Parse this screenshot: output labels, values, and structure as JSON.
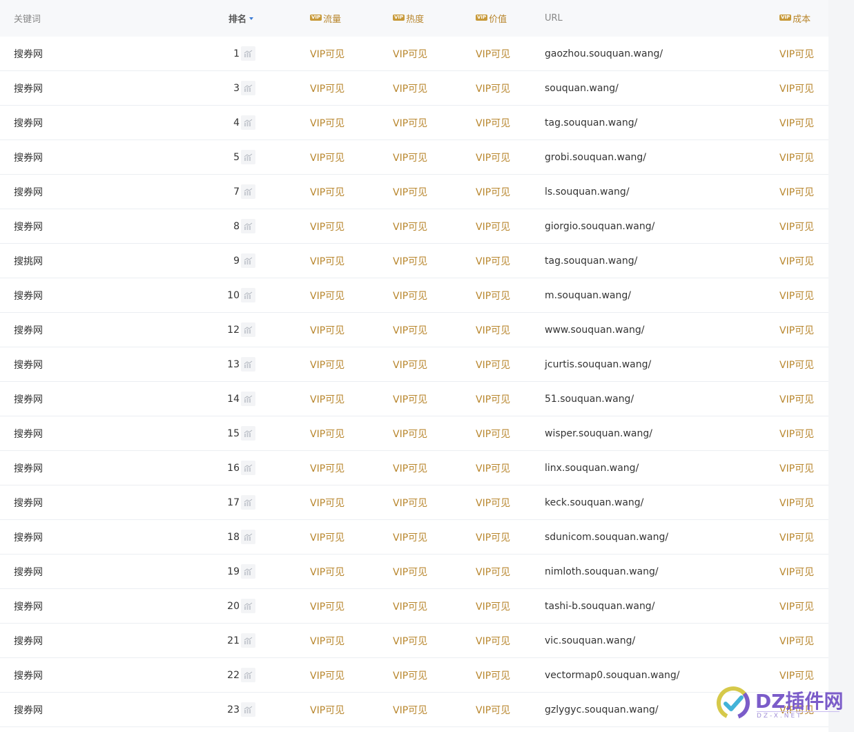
{
  "header": {
    "keyword": "关键词",
    "rank": "排名",
    "flow": "流量",
    "heat": "热度",
    "value": "价值",
    "url": "URL",
    "cost": "成本",
    "vip_badge": "VIP"
  },
  "vip_text": "VIP可见",
  "rows": [
    {
      "keyword": "搜券网",
      "rank": "1",
      "url": "gaozhou.souquan.wang/"
    },
    {
      "keyword": "搜券网",
      "rank": "3",
      "url": "souquan.wang/"
    },
    {
      "keyword": "搜券网",
      "rank": "4",
      "url": "tag.souquan.wang/"
    },
    {
      "keyword": "搜券网",
      "rank": "5",
      "url": "grobi.souquan.wang/"
    },
    {
      "keyword": "搜券网",
      "rank": "7",
      "url": "ls.souquan.wang/"
    },
    {
      "keyword": "搜券网",
      "rank": "8",
      "url": "giorgio.souquan.wang/"
    },
    {
      "keyword": "搜挑网",
      "rank": "9",
      "url": "tag.souquan.wang/"
    },
    {
      "keyword": "搜券网",
      "rank": "10",
      "url": "m.souquan.wang/"
    },
    {
      "keyword": "搜券网",
      "rank": "12",
      "url": "www.souquan.wang/"
    },
    {
      "keyword": "搜券网",
      "rank": "13",
      "url": "jcurtis.souquan.wang/"
    },
    {
      "keyword": "搜券网",
      "rank": "14",
      "url": "51.souquan.wang/"
    },
    {
      "keyword": "搜券网",
      "rank": "15",
      "url": "wisper.souquan.wang/"
    },
    {
      "keyword": "搜券网",
      "rank": "16",
      "url": "linx.souquan.wang/"
    },
    {
      "keyword": "搜券网",
      "rank": "17",
      "url": "keck.souquan.wang/"
    },
    {
      "keyword": "搜券网",
      "rank": "18",
      "url": "sdunicom.souquan.wang/"
    },
    {
      "keyword": "搜券网",
      "rank": "19",
      "url": "nimloth.souquan.wang/"
    },
    {
      "keyword": "搜券网",
      "rank": "20",
      "url": "tashi-b.souquan.wang/"
    },
    {
      "keyword": "搜券网",
      "rank": "21",
      "url": "vic.souquan.wang/"
    },
    {
      "keyword": "搜券网",
      "rank": "22",
      "url": "vectormap0.souquan.wang/"
    },
    {
      "keyword": "搜券网",
      "rank": "23",
      "url": "gzlygyc.souquan.wang/"
    }
  ],
  "watermark": {
    "brand": "DZ插件网",
    "sub": "DZ-X.NET"
  },
  "colors": {
    "vip_gold": "#b8862d",
    "sort_arrow": "#3a7bd5",
    "header_bg": "#f7f8fa"
  }
}
